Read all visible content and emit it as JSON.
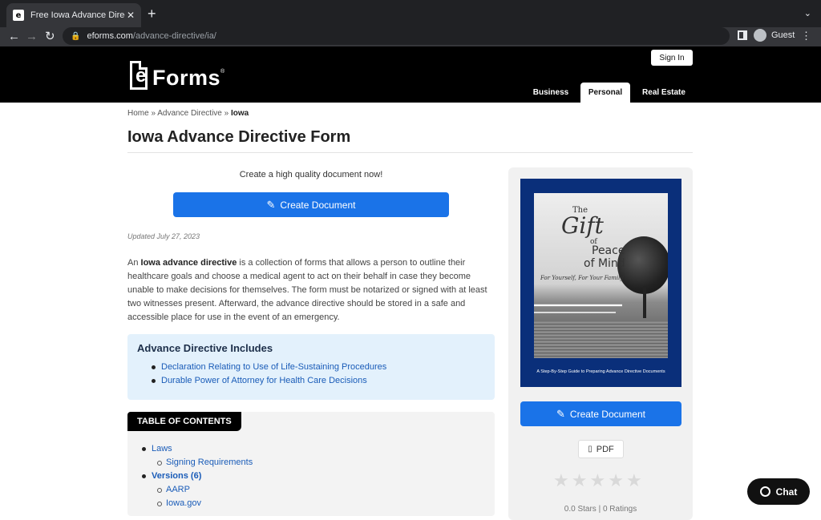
{
  "browser": {
    "tab_title": "Free Iowa Advance Directive F",
    "url_host": "eforms.com",
    "url_path": "/advance-directive/ia/",
    "profile_label": "Guest"
  },
  "header": {
    "signin_label": "Sign In",
    "logo_text": "Forms",
    "logo_e": "e",
    "logo_reg": "®",
    "nav": {
      "business": "Business",
      "personal": "Personal",
      "real_estate": "Real Estate"
    }
  },
  "breadcrumb": {
    "home": "Home",
    "sep": "»",
    "advance_directive": "Advance Directive",
    "current": "Iowa"
  },
  "page": {
    "title": "Iowa Advance Directive Form",
    "cta_text": "Create a high quality document now!",
    "create_button": "Create Document",
    "updated": "Updated July 27, 2023",
    "intro_prefix": "An ",
    "intro_bold": "Iowa advance directive",
    "intro_rest": " is a collection of forms that allows a person to outline their healthcare goals and choose a medical agent to act on their behalf in case they become unable to make decisions for themselves. The form must be notarized or signed with at least two witnesses present. Afterward, the advance directive should be stored in a safe and accessible place for use in the event of an emergency."
  },
  "includes": {
    "title": "Advance Directive Includes",
    "items": [
      "Declaration Relating to Use of Life-Sustaining Procedures",
      "Durable Power of Attorney for Health Care Decisions"
    ]
  },
  "toc": {
    "label": "TABLE OF CONTENTS",
    "laws": "Laws",
    "signing": "Signing Requirements",
    "versions": "Versions (6)",
    "aarp": "AARP",
    "iowa_gov": "Iowa.gov"
  },
  "sidebar": {
    "book": {
      "the": "The",
      "gift": "Gift",
      "of": "of",
      "peace": "Peace",
      "mind": "of Mind",
      "tagline": "For Yourself, For Your Family",
      "caption": "A Step-By-Step Guide to Preparing Advance Directive Documents"
    },
    "create_button": "Create Document",
    "pdf_label": "PDF",
    "stars_value": 0,
    "stars_max": 5,
    "rating_text": "0.0 Stars | 0 Ratings"
  },
  "chat": {
    "label": "Chat"
  }
}
